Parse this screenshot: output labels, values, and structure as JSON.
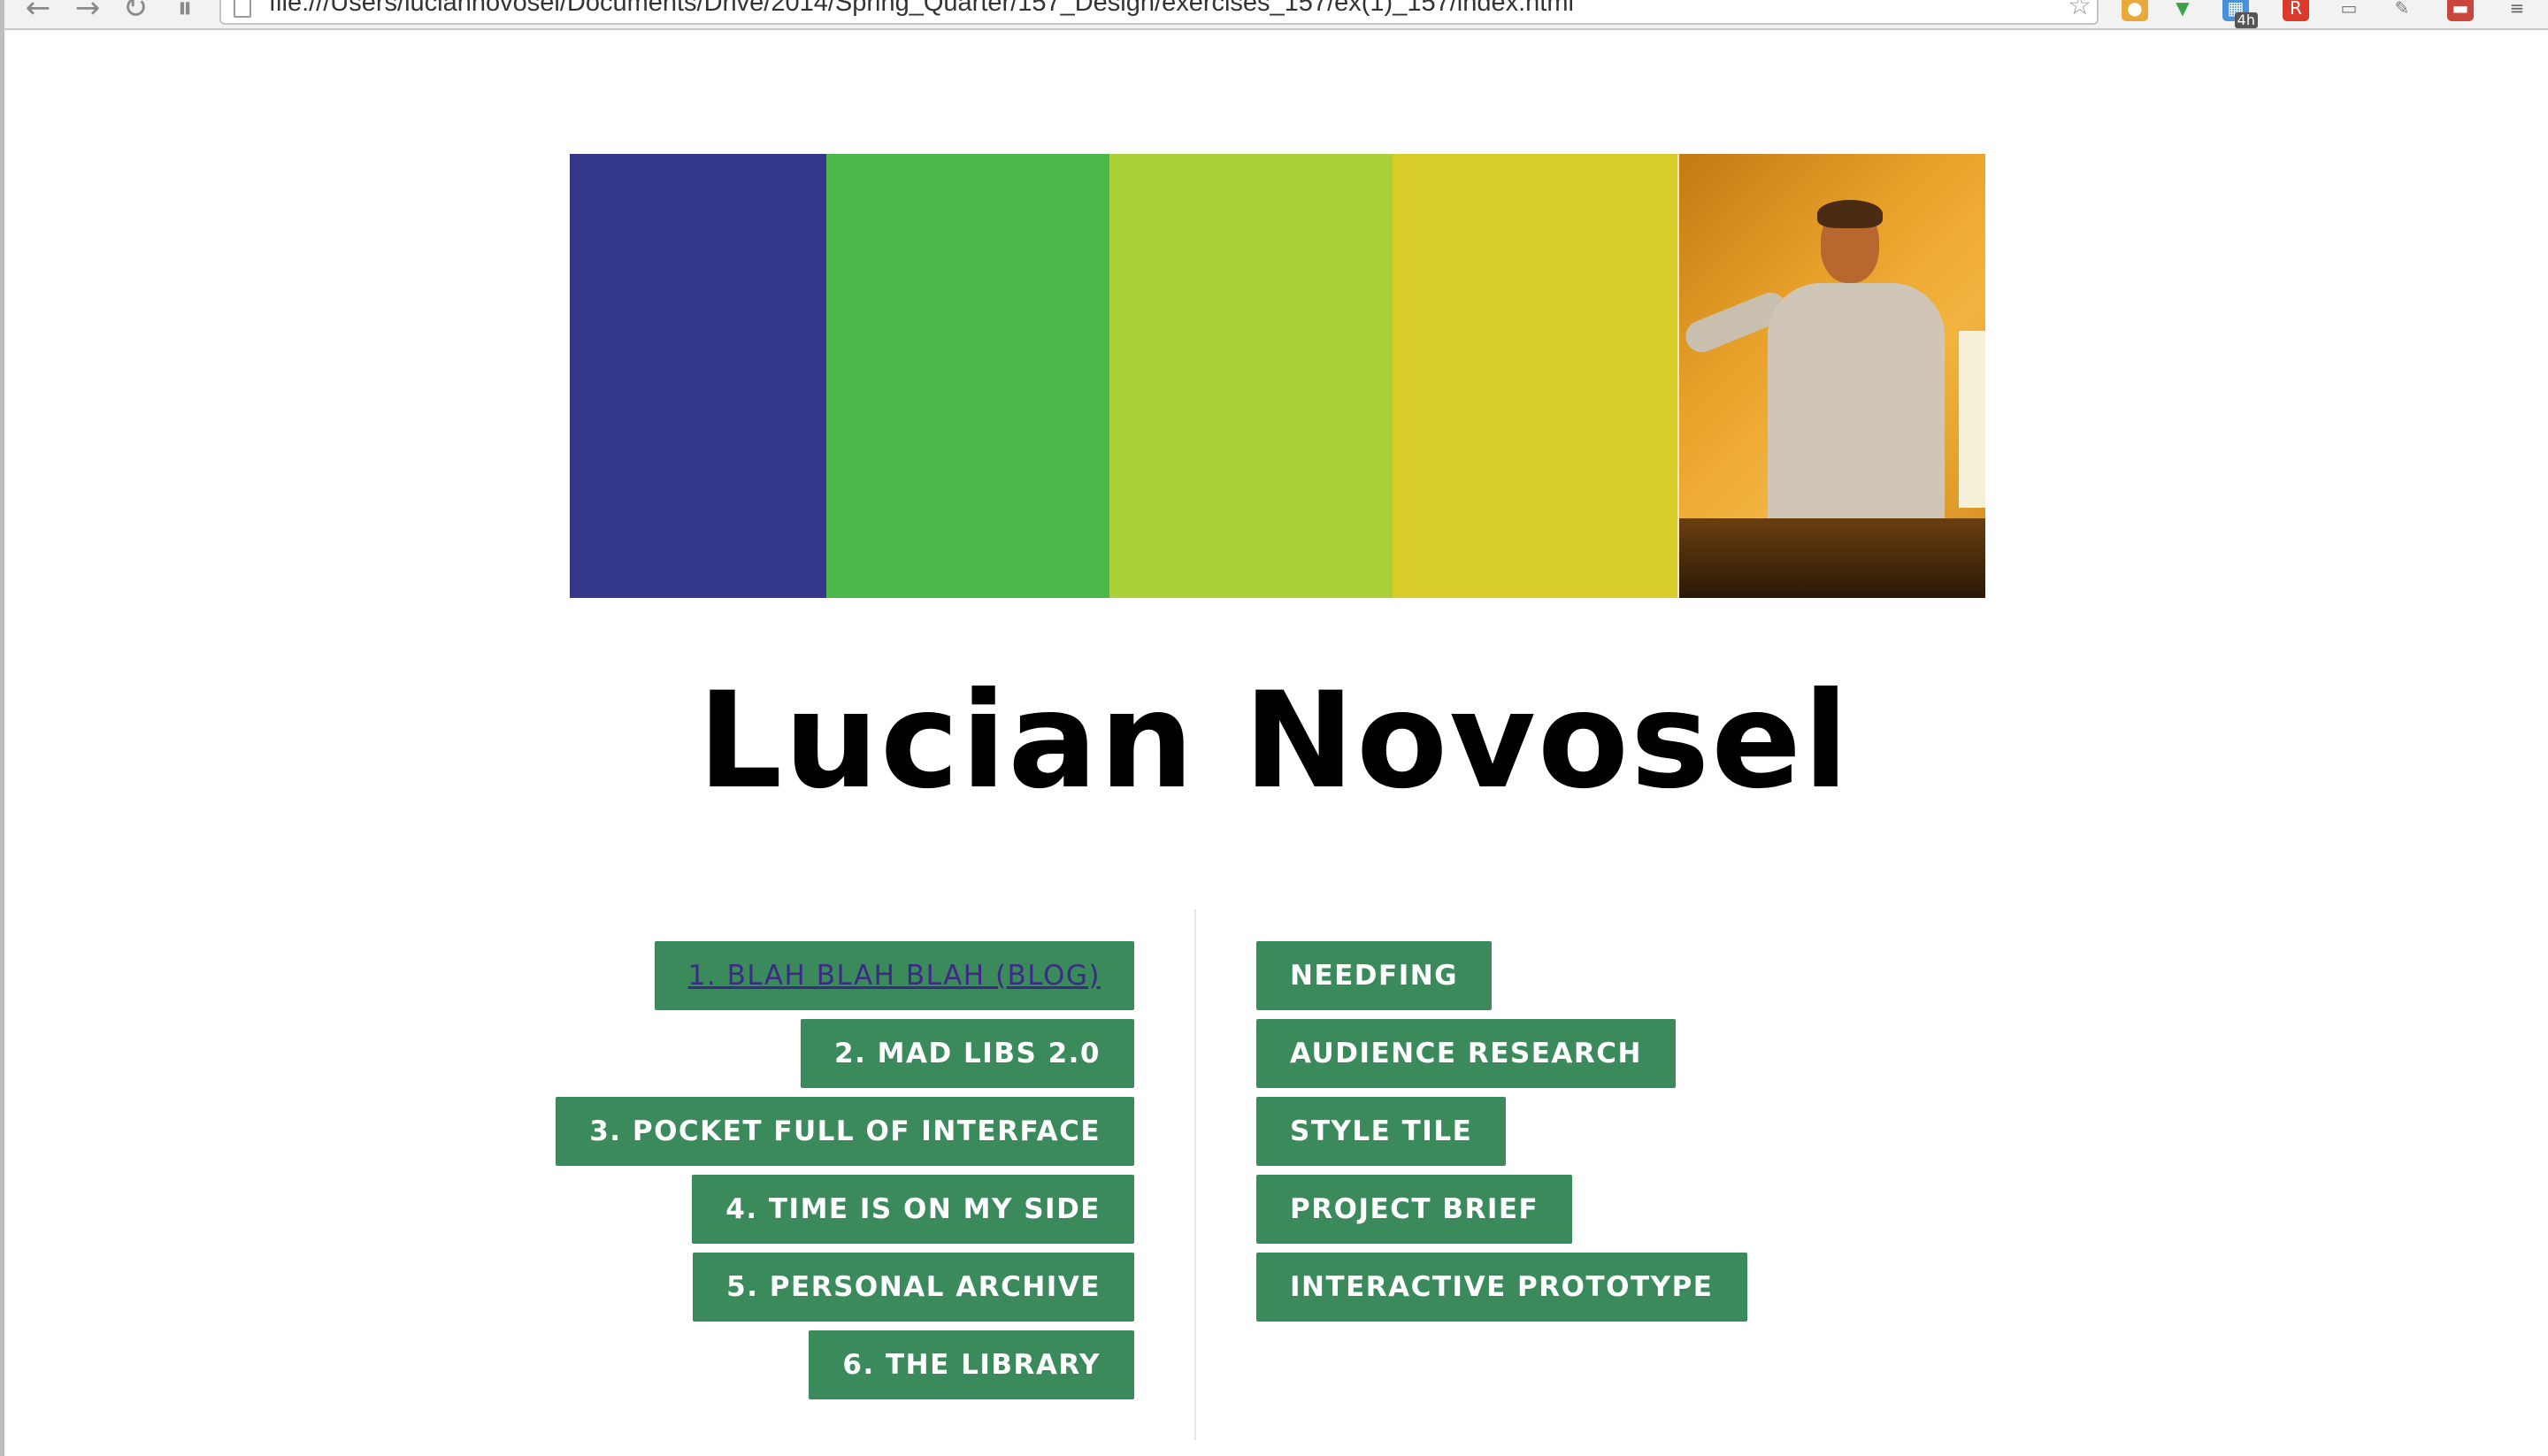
{
  "browser": {
    "url": "file:///Users/luciannovosel/Documents/Drive/2014/Spring_Quarter/157_Design/exercises_157/ex(1)_157/index.html",
    "extension_badge": "4h",
    "extension_r": "R"
  },
  "banner": {
    "stripes": [
      {
        "color": "#35388a"
      },
      {
        "color": "#4db84a"
      },
      {
        "color": "#acd037"
      },
      {
        "color": "#d7cc28"
      }
    ]
  },
  "page": {
    "name": "Lucian Novosel"
  },
  "nav": {
    "left": [
      {
        "label": "1. BLAH BLAH BLAH (BLOG)",
        "visited": true
      },
      {
        "label": "2. MAD LIBS 2.0",
        "visited": false
      },
      {
        "label": "3. POCKET FULL OF INTERFACE",
        "visited": false
      },
      {
        "label": "4. TIME IS ON MY SIDE",
        "visited": false
      },
      {
        "label": "5. PERSONAL ARCHIVE",
        "visited": false
      },
      {
        "label": "6. THE LIBRARY",
        "visited": false
      }
    ],
    "right": [
      {
        "label": "NEEDFING"
      },
      {
        "label": "AUDIENCE RESEARCH"
      },
      {
        "label": "STYLE TILE"
      },
      {
        "label": "PROJECT BRIEF"
      },
      {
        "label": "INTERACTIVE PROTOTYPE"
      }
    ],
    "button_color": "#3b8a5c"
  }
}
